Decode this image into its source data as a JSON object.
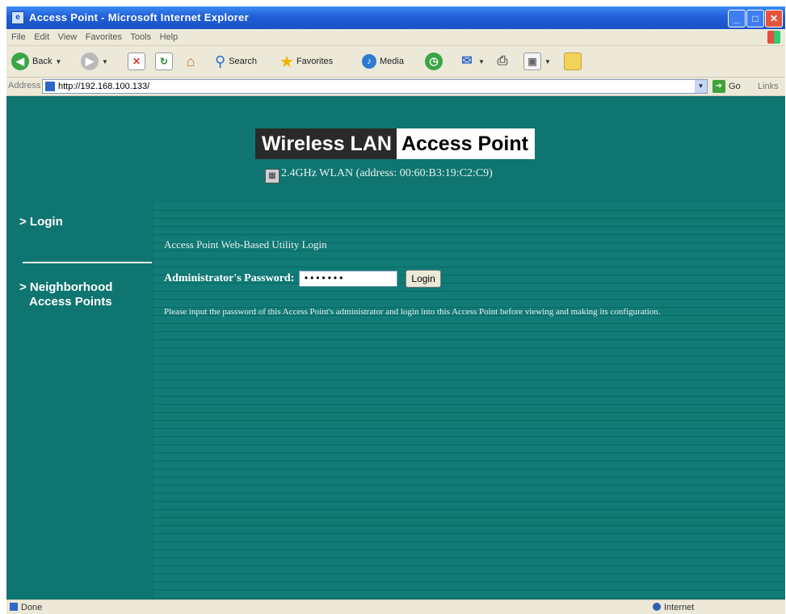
{
  "window": {
    "title": "Access Point - Microsoft Internet Explorer"
  },
  "menu": [
    "File",
    "Edit",
    "View",
    "Favorites",
    "Tools",
    "Help"
  ],
  "toolbar": {
    "back_label": "Back",
    "search_label": "Search",
    "favorites_label": "Favorites",
    "media_label": "Media"
  },
  "address": {
    "label": "Address",
    "url": "http://192.168.100.133/",
    "go_label": "Go",
    "links_label": "Links"
  },
  "header": {
    "title_part1": "Wireless LAN",
    "title_part2": "Access Point",
    "subtitle": "2.4GHz WLAN (address: 00:60:B3:19:C2:C9)"
  },
  "nav": {
    "login": "> Login",
    "neighborhood_line1": "> Neighborhood",
    "neighborhood_line2": "Access Points"
  },
  "main": {
    "heading": "Access Point Web-Based Utility Login",
    "password_label": "Administrator's Password:",
    "password_value": "•••••••",
    "login_button": "Login",
    "note": "Please input the password of this Access Point's administrator and login into this Access Point before viewing and making its configuration."
  },
  "status": {
    "left": "Done",
    "zone": "Internet"
  },
  "colors": {
    "page_bg": "#0f7570",
    "titlebar": "#1f5fd6"
  }
}
